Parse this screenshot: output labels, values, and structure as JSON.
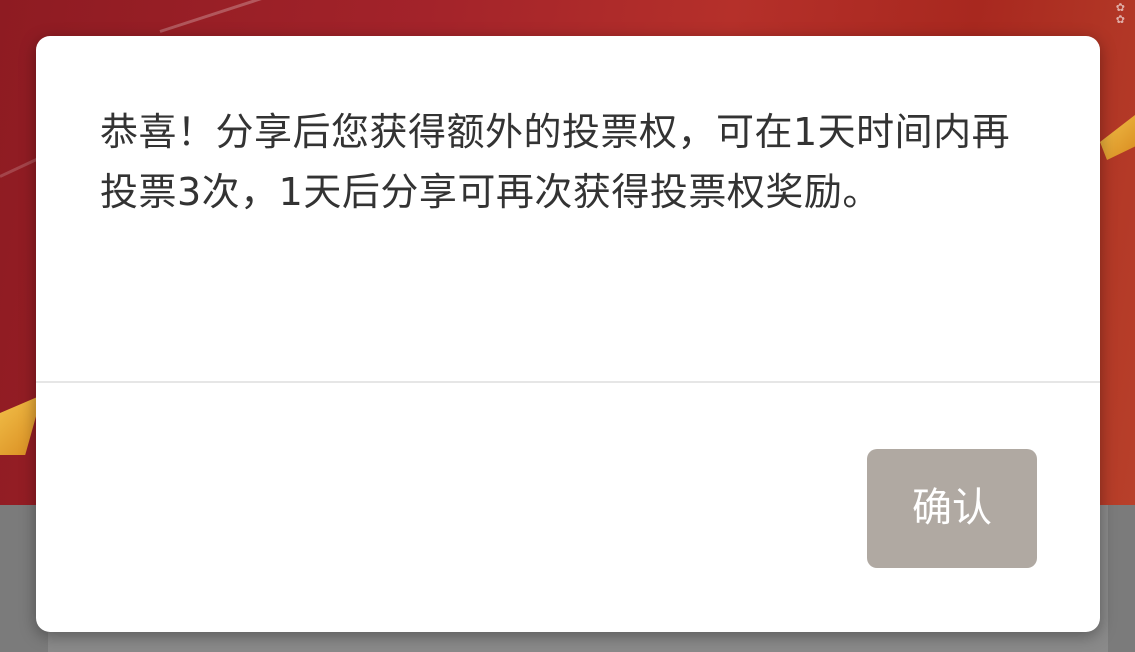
{
  "background": {
    "banner_color": "#a3232a",
    "accent_gold": "#f2c14a",
    "overlay_gray": "#7b7b7b"
  },
  "dialog": {
    "message": "恭喜！分享后您获得额外的投票权，可在1天时间内再投票3次，1天后分享可再次获得投票权奖励。",
    "confirm_label": "确认",
    "confirm_color": "#b0a9a2"
  }
}
